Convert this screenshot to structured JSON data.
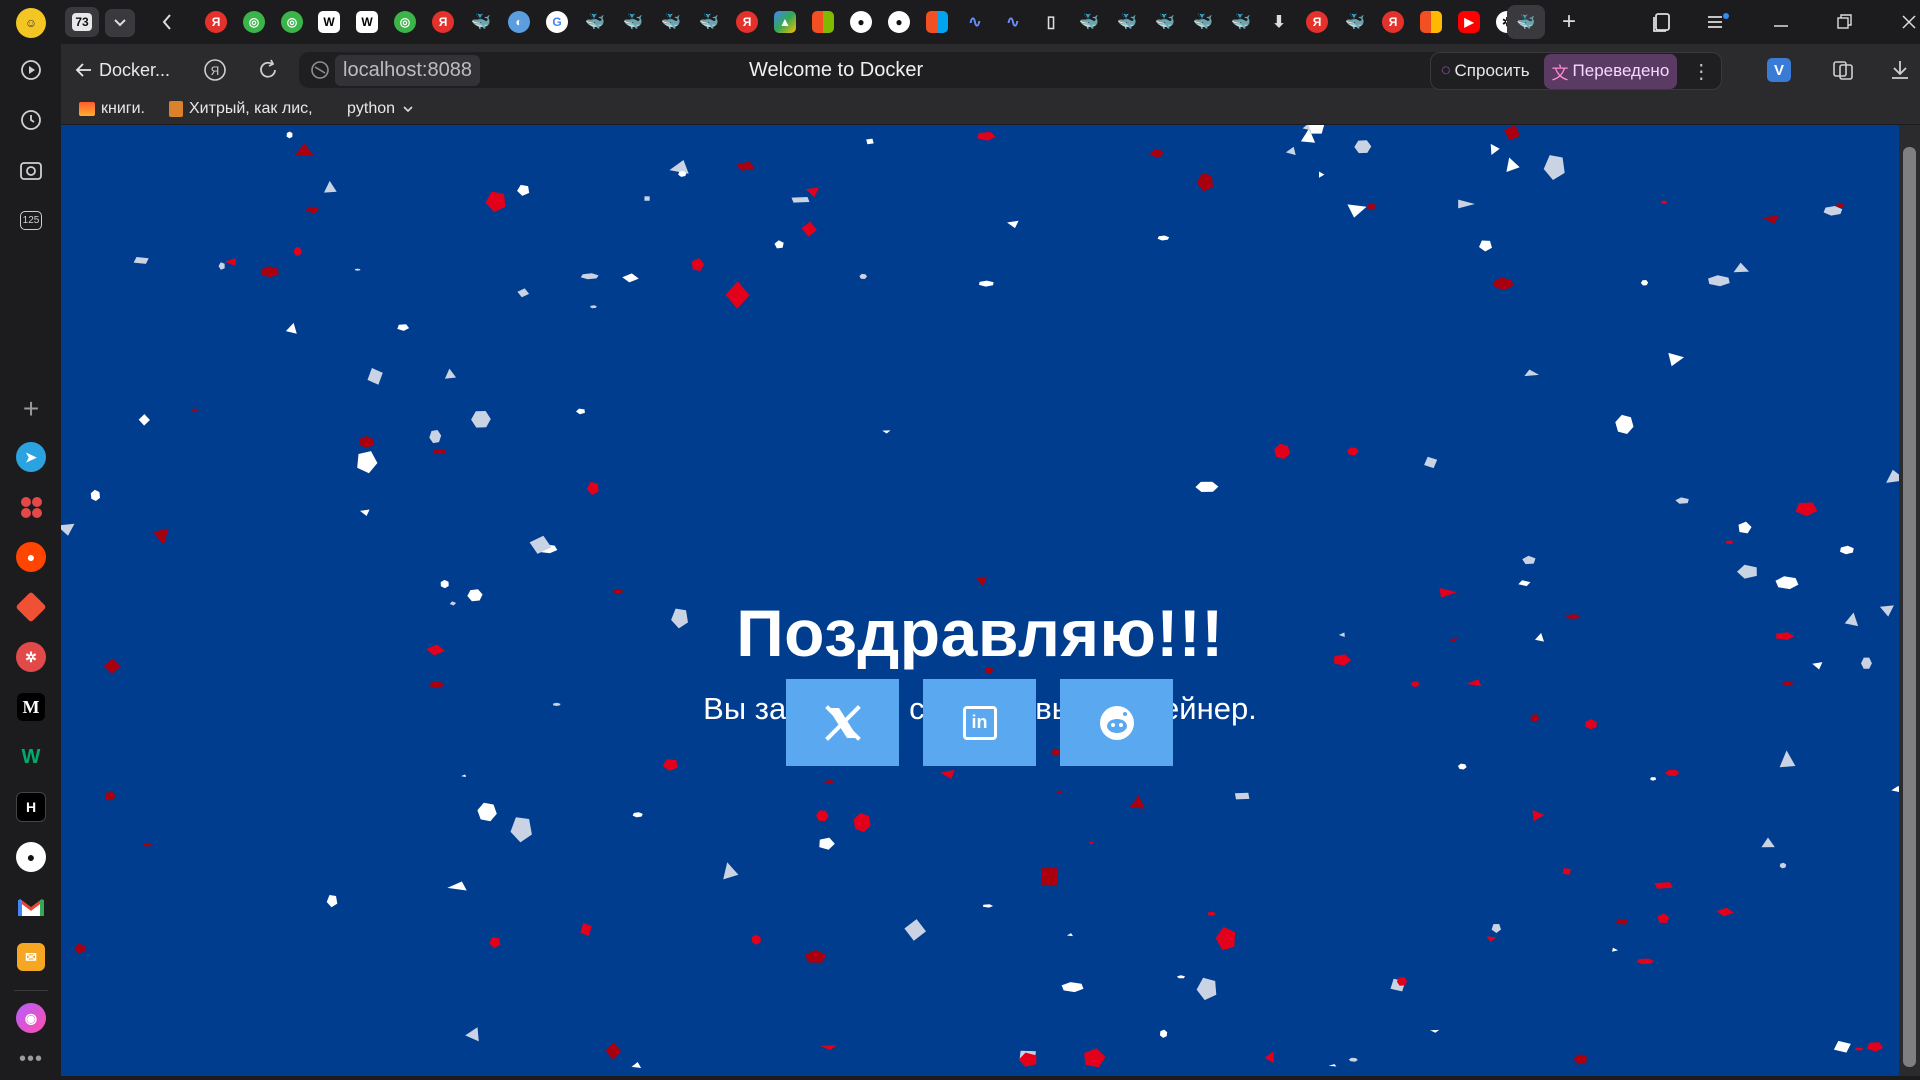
{
  "tabs": {
    "count_badge": "73",
    "new_tab_label": "+"
  },
  "toolbar": {
    "back_label": "Docker...",
    "address": "localhost:8088",
    "page_title": "Welcome to Docker",
    "ask_label": "Спросить",
    "translated_label": "Переведено",
    "v_badge": "V"
  },
  "bookmarks": [
    {
      "label": "книги."
    },
    {
      "label": "Хитрый, как лис,"
    },
    {
      "label": "python"
    }
  ],
  "sidebar": {
    "counter_badge": "125",
    "medium_label": "M",
    "w3_label": "W",
    "hn_label": "H"
  },
  "hero": {
    "title": "Поздравляю!!!",
    "subtitle": "Вы запустили свой первый контейнер."
  },
  "social": [
    {
      "name": "x",
      "icon": "x-logo-icon"
    },
    {
      "name": "linkedin",
      "icon": "linkedin-icon",
      "label": "in"
    },
    {
      "name": "reddit",
      "icon": "reddit-icon"
    }
  ],
  "colors": {
    "page_background": "#003d8f",
    "button_background": "#5aa9f0",
    "confetti_red": "#e3001b",
    "confetti_white": "#ffffff"
  }
}
